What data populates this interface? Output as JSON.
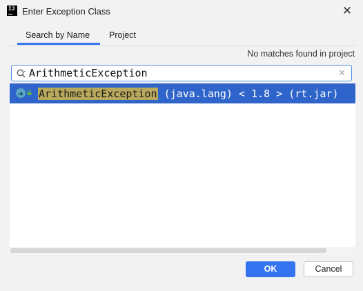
{
  "dialog": {
    "title": "Enter Exception Class",
    "close_glyph": "✕",
    "app_logo_text": "IJ"
  },
  "tabs": [
    {
      "label": "Search by Name",
      "selected": true
    },
    {
      "label": "Project",
      "selected": false
    }
  ],
  "status": "No matches found in project",
  "search": {
    "value": "ArithmeticException",
    "clear_glyph": "✕"
  },
  "results": [
    {
      "name": "ArithmeticException",
      "detail": " (java.lang) < 1.8 > (rt.jar)",
      "icon": "exception-class-icon",
      "visibility_icon": "public-lock-icon",
      "selected": true
    }
  ],
  "buttons": {
    "ok": "OK",
    "cancel": "Cancel"
  },
  "colors": {
    "accent": "#3574f0",
    "selection": "#2f65ca",
    "match_highlight": "#b9a95c"
  }
}
